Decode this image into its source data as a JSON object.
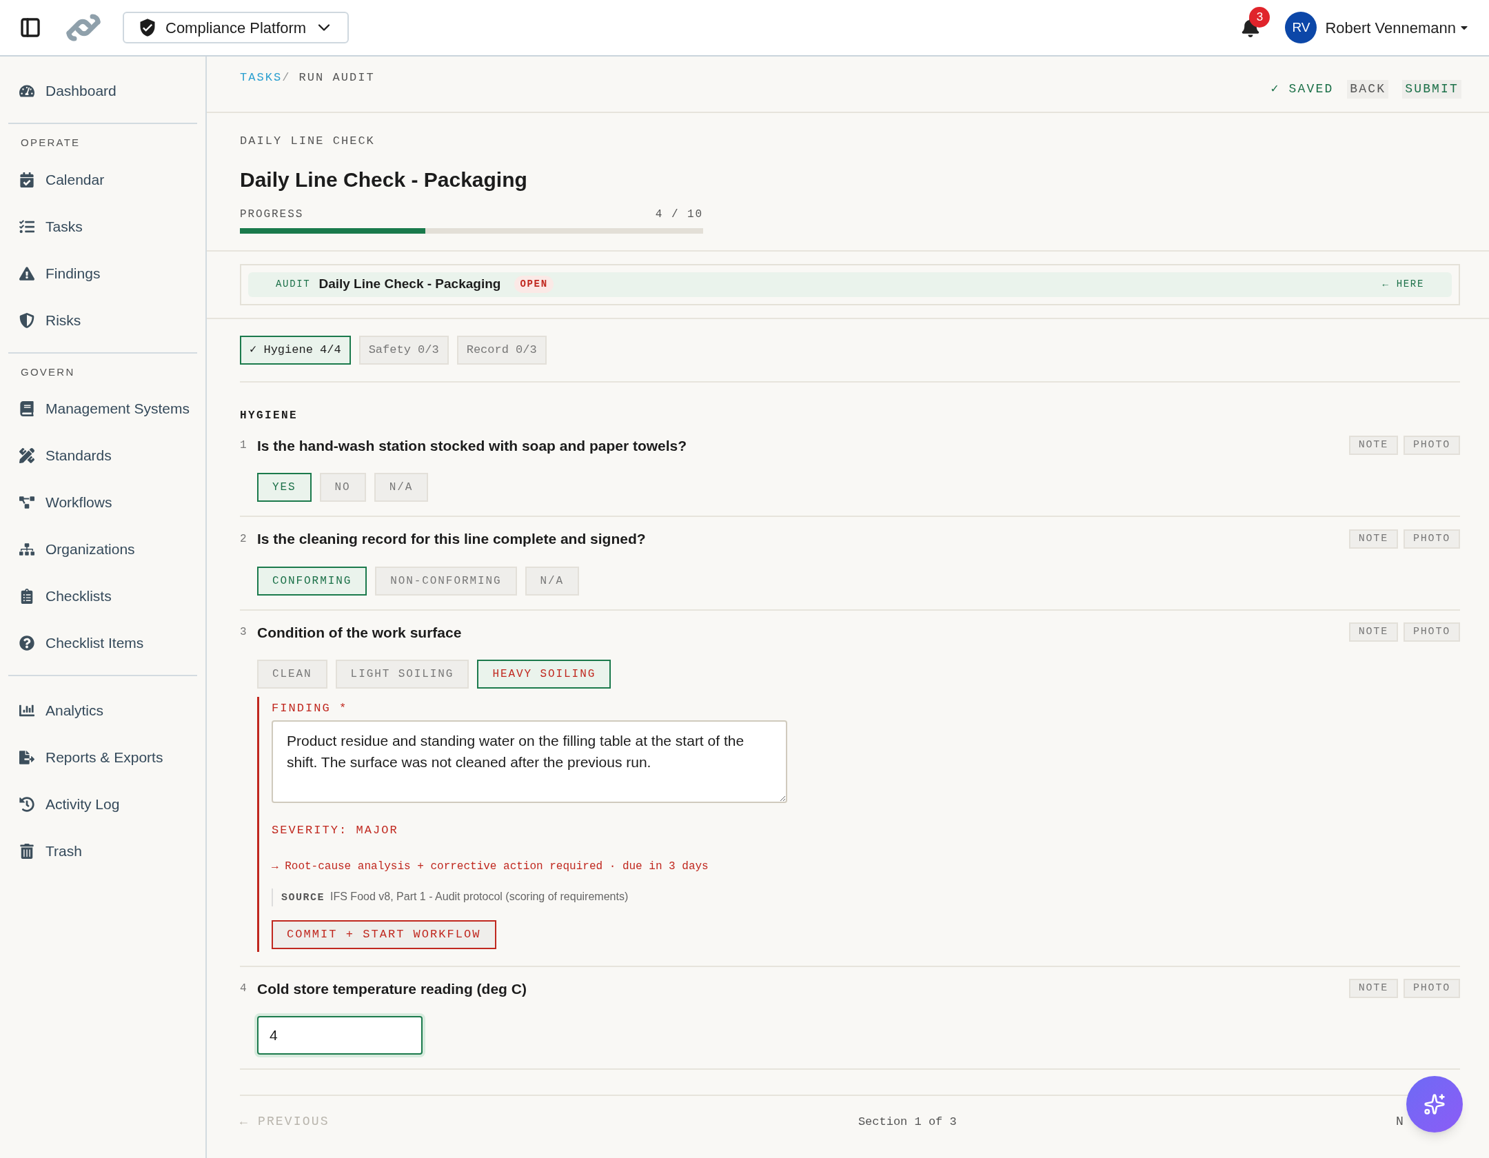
{
  "topbar": {
    "workspace": "Compliance Platform",
    "notifications": "3",
    "user": {
      "initials": "RV",
      "name": "Robert Vennemann"
    }
  },
  "sidebar": {
    "groups": [
      {
        "items": [
          {
            "label": "Dashboard",
            "selected": false
          }
        ]
      },
      {
        "title": "OPERATE",
        "items": [
          {
            "label": "Calendar",
            "selected": false
          },
          {
            "label": "Tasks",
            "selected": false
          },
          {
            "label": "Findings",
            "selected": false
          },
          {
            "label": "Risks",
            "selected": false
          }
        ]
      },
      {
        "title": "GOVERN",
        "items": [
          {
            "label": "Management Systems",
            "selected": false
          },
          {
            "label": "Standards",
            "selected": false
          },
          {
            "label": "Workflows",
            "selected": false
          },
          {
            "label": "Organizations",
            "selected": false
          },
          {
            "label": "Checklists",
            "selected": false
          },
          {
            "label": "Checklist Items",
            "selected": false
          }
        ]
      },
      {
        "items": [
          {
            "label": "Analytics",
            "selected": false
          },
          {
            "label": "Reports & Exports",
            "selected": false
          },
          {
            "label": "Activity Log",
            "selected": false
          },
          {
            "label": "Trash",
            "selected": false
          }
        ]
      }
    ]
  },
  "breadcrumb": {
    "link": "TASKS",
    "separator": "/",
    "current": "RUN AUDIT"
  },
  "actions": {
    "saved": "✓ SAVED",
    "back": "BACK",
    "submit": "SUBMIT"
  },
  "header": {
    "eyebrow": "DAILY LINE CHECK",
    "title": "Daily Line Check - Packaging",
    "progress_label": "PROGRESS",
    "progress_text": "4 / 10",
    "level": 0.4
  },
  "audit_bar": {
    "tag": "AUDIT",
    "name": "Daily Line Check - Packaging",
    "status": "OPEN",
    "here": "← HERE"
  },
  "tabs": [
    {
      "label": "✓ Hygiene 4/4",
      "selected": true
    },
    {
      "label": "Safety 0/3",
      "selected": false
    },
    {
      "label": "Record 0/3",
      "selected": false
    }
  ],
  "section_title": "HYGIENE",
  "questions": [
    {
      "number": "1",
      "text": "Is the hand-wash station stocked with soap and paper towels?",
      "buttons": [
        "NOTE",
        "PHOTO"
      ],
      "kind": "choice",
      "options": [
        {
          "label": "YES",
          "selected": true,
          "flagged": false
        },
        {
          "label": "NO",
          "selected": false,
          "flagged": false
        },
        {
          "label": "N/A",
          "selected": false,
          "flagged": false
        }
      ]
    },
    {
      "number": "2",
      "text": "Is the cleaning record for this line complete and signed?",
      "buttons": [
        "NOTE",
        "PHOTO"
      ],
      "kind": "choice",
      "options": [
        {
          "label": "CONFORMING",
          "selected": true,
          "flagged": false
        },
        {
          "label": "NON-CONFORMING",
          "selected": false,
          "flagged": false
        },
        {
          "label": "N/A",
          "selected": false,
          "flagged": false
        }
      ]
    },
    {
      "number": "3",
      "text": "Condition of the work surface",
      "buttons": [
        "NOTE",
        "PHOTO"
      ],
      "kind": "choice",
      "options": [
        {
          "label": "CLEAN",
          "selected": false,
          "flagged": false
        },
        {
          "label": "LIGHT SOILING",
          "selected": false,
          "flagged": false
        },
        {
          "label": "HEAVY SOILING",
          "selected": true,
          "flagged": true
        }
      ],
      "finding": {
        "label": "FINDING *",
        "text": "Product residue and standing water on the filling table at the start of the shift. The surface was not cleaned after the previous run.",
        "severity": "SEVERITY: MAJOR",
        "action": "→ Root-cause analysis + corrective action required · due in 3 days",
        "source_label": "SOURCE",
        "source": "IFS Food v8, Part 1 - Audit protocol (scoring of requirements)",
        "button": "COMMIT + START WORKFLOW"
      }
    },
    {
      "number": "4",
      "text": "Cold store temperature reading (deg C)",
      "buttons": [
        "NOTE",
        "PHOTO"
      ],
      "kind": "number",
      "value": "4"
    }
  ],
  "footer": {
    "previous": {
      "label": "← PREVIOUS",
      "disabled": true
    },
    "section": "Section 1 of 3",
    "next": {
      "label": "N",
      "disabled": false
    }
  }
}
